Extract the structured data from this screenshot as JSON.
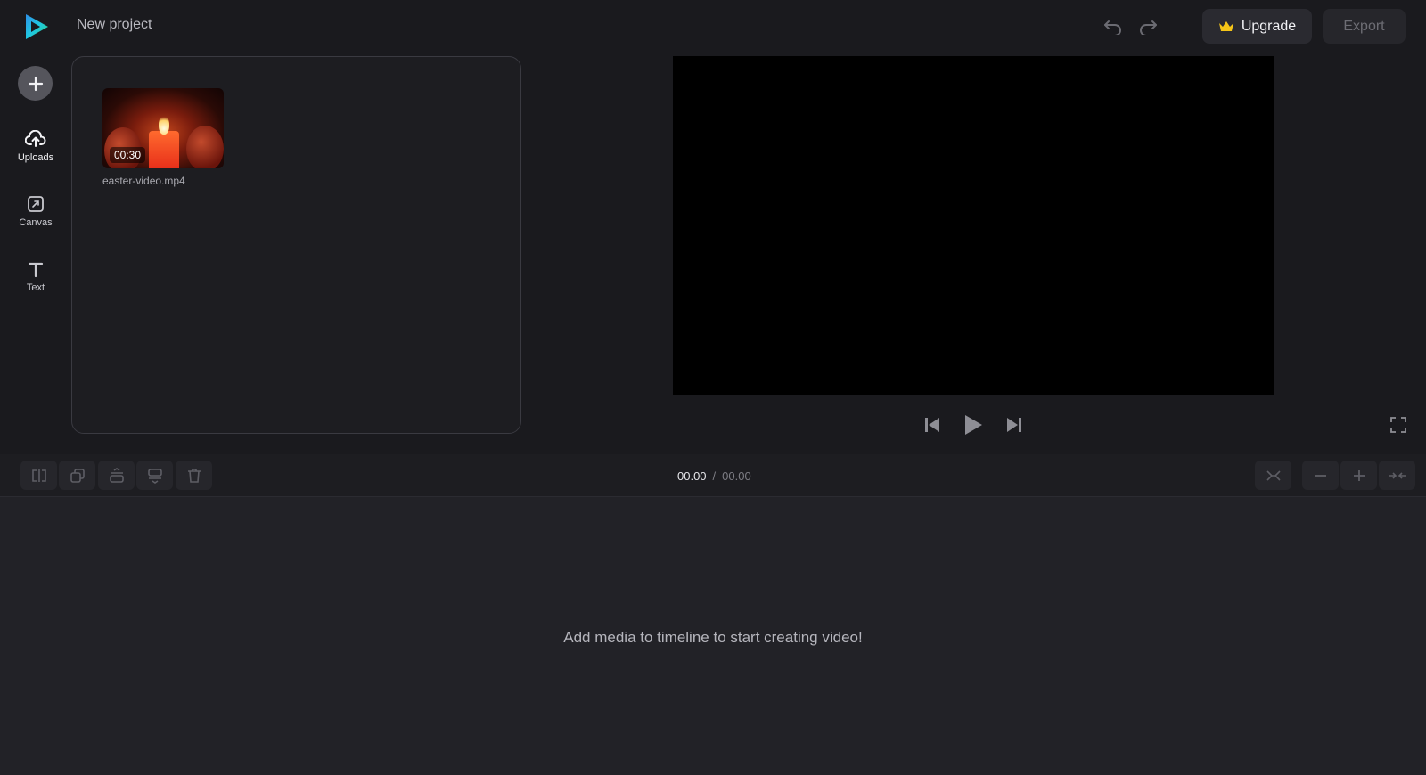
{
  "app": {
    "project_title": "New project"
  },
  "header": {
    "upgrade_label": "Upgrade",
    "export_label": "Export"
  },
  "sidebar": {
    "items": [
      {
        "label": "Uploads",
        "icon": "cloud-upload-icon"
      },
      {
        "label": "Canvas",
        "icon": "canvas-resize-icon"
      },
      {
        "label": "Text",
        "icon": "text-icon"
      }
    ]
  },
  "media": {
    "items": [
      {
        "filename": "easter-video.mp4",
        "duration": "00:30"
      }
    ]
  },
  "timeline": {
    "current_time": "00.00",
    "separator": "/",
    "total_time": "00.00",
    "empty_message": "Add media to timeline to start creating video!"
  },
  "colors": {
    "background": "#1a1a1e",
    "panel_border": "#3a3a41",
    "upgrade_crown": "#f5c518",
    "logo_cyan": "#1fc8e0",
    "logo_green": "#2ecf7a"
  }
}
